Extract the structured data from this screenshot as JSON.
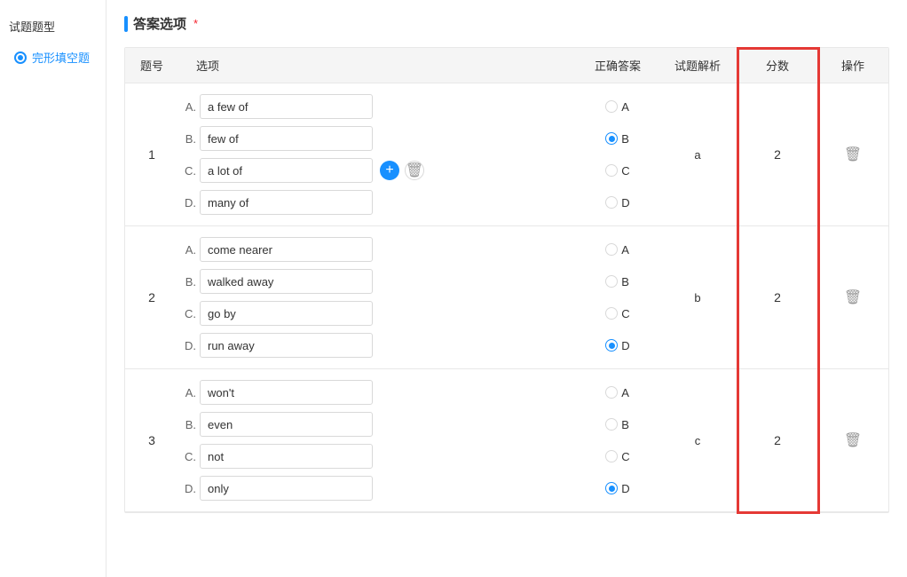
{
  "section": {
    "title": "答案选项",
    "required_mark": "*"
  },
  "sidebar": {
    "title": "试题题型",
    "item_label": "完形填空题"
  },
  "table": {
    "headers": [
      "题号",
      "选项",
      "正确答案",
      "试题解析",
      "分数",
      "操作"
    ],
    "questions": [
      {
        "num": "1",
        "options": [
          {
            "label": "A.",
            "value": "a few of"
          },
          {
            "label": "B.",
            "value": "few of"
          },
          {
            "label": "C.",
            "value": "a lot of"
          },
          {
            "label": "D.",
            "value": "many of"
          }
        ],
        "answers": [
          "A",
          "B",
          "C",
          "D"
        ],
        "correct": "B",
        "explanation": "a",
        "score": "2",
        "show_add_del": true,
        "add_del_row": 2
      },
      {
        "num": "2",
        "options": [
          {
            "label": "A.",
            "value": "come nearer"
          },
          {
            "label": "B.",
            "value": "walked away"
          },
          {
            "label": "C.",
            "value": "go by"
          },
          {
            "label": "D.",
            "value": "run away"
          }
        ],
        "answers": [
          "A",
          "B",
          "C",
          "D"
        ],
        "correct": "D",
        "explanation": "b",
        "score": "2",
        "show_add_del": false,
        "add_del_row": -1
      },
      {
        "num": "3",
        "options": [
          {
            "label": "A.",
            "value": "won't"
          },
          {
            "label": "B.",
            "value": "even"
          },
          {
            "label": "C.",
            "value": "not"
          },
          {
            "label": "D.",
            "value": "only"
          }
        ],
        "answers": [
          "A",
          "B",
          "C",
          "D"
        ],
        "correct": "D",
        "explanation": "c",
        "score": "2",
        "show_add_del": false,
        "add_del_row": -1
      }
    ]
  }
}
